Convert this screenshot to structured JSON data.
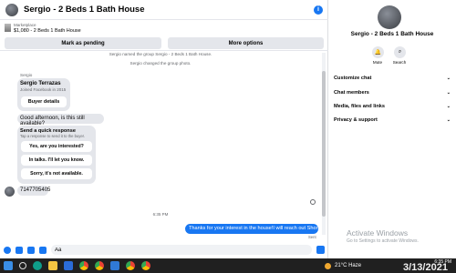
{
  "chat": {
    "header_title": "Sergio - 2 Beds 1 Bath House",
    "listing_category": "Marketplace",
    "listing_title": "$1,080 - 2 Beds 1 Bath House",
    "mark_pending": "Mark as pending",
    "more_options": "More options",
    "system_messages": [
      "Sergio named the group Sergio - 2 Beds 1 Bath House.",
      "Sergio changed the group photo."
    ],
    "sender": "Sergio",
    "msg1_name": "Sergio Terrazas",
    "msg1_sub": "Joined Facebook in 2015",
    "buyer_details": "Buyer details",
    "msg2": "Good afternoon, is this still available?",
    "quick_title": "Send a quick response",
    "quick_sub": "Tap a response to send it to the buyer.",
    "quick_responses": [
      "Yes, are you interested?",
      "In talks. I'll let you know.",
      "Sorry, it's not available."
    ],
    "msg4": "7147705405",
    "time": "6:35 PM",
    "msg5": "Thanks for your interest in the house!I will reach out Shortly.",
    "sent": "Sent",
    "input_value": "Aa"
  },
  "side": {
    "name": "Sergio - 2 Beds 1 Bath House",
    "mute": "Mute",
    "search": "Search",
    "rows": [
      "Customize chat",
      "Chat members",
      "Media, files and links",
      "Privacy & support"
    ],
    "activate_title": "Activate Windows",
    "activate_sub": "Go to Settings to activate Windows."
  },
  "taskbar": {
    "weather": "21°C Haze",
    "time": "6:35 PM",
    "date": "3/13/2021"
  }
}
